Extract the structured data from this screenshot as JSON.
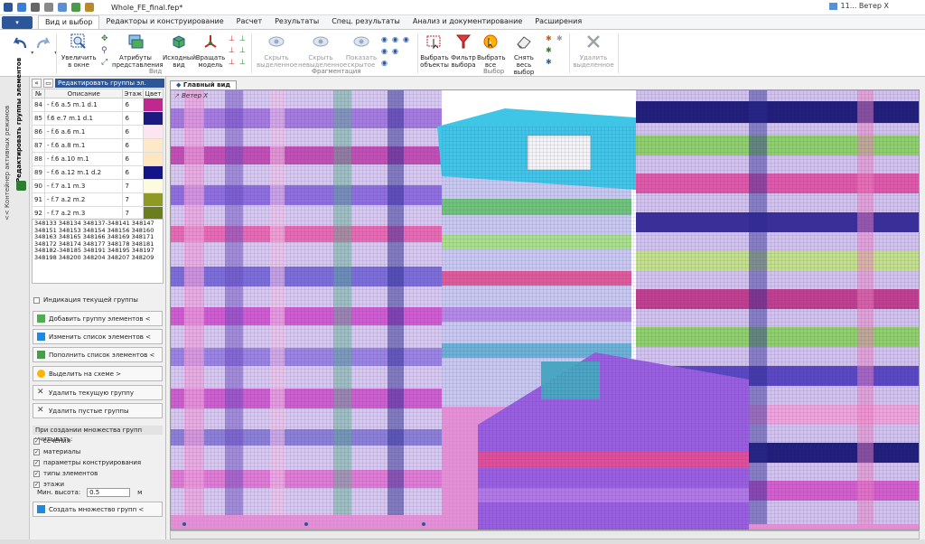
{
  "window": {
    "title": "Whole_FE_final.fep*",
    "loadcase": "11... Ветер X"
  },
  "tabs": [
    {
      "label": "Вид и выбор",
      "active": true
    },
    {
      "label": "Редакторы и конструирование",
      "active": false
    },
    {
      "label": "Расчет",
      "active": false
    },
    {
      "label": "Результаты",
      "active": false
    },
    {
      "label": "Спец. результаты",
      "active": false
    },
    {
      "label": "Анализ и документирование",
      "active": false
    },
    {
      "label": "Расширения",
      "active": false
    }
  ],
  "ribbon": {
    "view": {
      "zoom_window": "Увеличить\nв окне",
      "attributes": "Атрибуты\nпредставления",
      "initial_view": "Исходный\nвид",
      "rotate_model": "Вращать\nмодель",
      "group_label": "Вид"
    },
    "fragmentation": {
      "hide_selected": "Скрыть\nвыделенное",
      "hide_unselected": "Скрыть\nневыделенное",
      "show_hidden": "Показать\nскрытое",
      "group_label": "Фрагментация"
    },
    "selection": {
      "select_objects": "Выбрать\nобъекты",
      "selection_filter": "Фильтр\nвыбора",
      "select_all": "Выбрать\nвсе",
      "deselect_all": "Снять весь\nвыбор",
      "group_label": "Выбор"
    },
    "delete_selected": "Удалить\nвыделенное"
  },
  "side_strip": {
    "container_label": "<< Контейнер активных режимов",
    "mode_label": "Редактировать группы элементов"
  },
  "panel": {
    "title": "Редактировать группы эл.",
    "columns": [
      "№",
      "Описание",
      "Этаж",
      "Цвет"
    ],
    "rows": [
      {
        "num": "84",
        "desc": "- f.6 a.5 m.1 d.1",
        "floor": "6",
        "color": "#c0288f"
      },
      {
        "num": "85",
        "desc": "f.6 e.7 m.1 d.1",
        "floor": "6",
        "color": "#1a1a80"
      },
      {
        "num": "86",
        "desc": "- f.6 a.6 m.1",
        "floor": "6",
        "color": "#fde4f1"
      },
      {
        "num": "87",
        "desc": "- f.6 a.8 m.1",
        "floor": "6",
        "color": "#fde8c8"
      },
      {
        "num": "88",
        "desc": "- f.6 a.10 m.1",
        "floor": "6",
        "color": "#fee6c0"
      },
      {
        "num": "89",
        "desc": "- f.6 a.12 m.1 d.2",
        "floor": "6",
        "color": "#14148a"
      },
      {
        "num": "90",
        "desc": "- f.7 a.1 m.3",
        "floor": "7",
        "color": "#fcfbe0"
      },
      {
        "num": "91",
        "desc": "- f.7 a.2 m.2",
        "floor": "7",
        "color": "#8f9a22"
      },
      {
        "num": "92",
        "desc": "- f.7 a.2 m.3",
        "floor": "7",
        "color": "#6a7e1e"
      }
    ],
    "ids_text": "348133 348134 348137-348141 348147 348151 348153 348154 348156 348160 348163 348165 348166 348169 348171 348172 348174 348177 348178 348181 348182-348185 348191 348195 348197 348198 348200 348204 348207 348209",
    "show_current_group": "Индикация текущей группы",
    "add_group": "Добавить группу элементов <",
    "edit_list": "Изменить список элементов <",
    "append_list": "Пополнить список элементов <",
    "highlight_on_scheme": "Выделить на схеме >",
    "delete_current_group": "Удалить текущую группу",
    "delete_empty_groups": "Удалить пустые группы",
    "section_title": "При создании множества групп учитывать:",
    "options": [
      {
        "label": "сечения",
        "checked": true
      },
      {
        "label": "материалы",
        "checked": true
      },
      {
        "label": "параметры конструирования",
        "checked": true
      },
      {
        "label": "типы элементов",
        "checked": true
      },
      {
        "label": "этажи",
        "checked": true
      }
    ],
    "min_height_label": "Мин. высота:",
    "min_height_value": "0.5",
    "min_height_unit": "м",
    "create_groups": "Создать множество групп <"
  },
  "viewport": {
    "tab_label": "Главный вид",
    "loadcase_label": "Ветер X"
  }
}
